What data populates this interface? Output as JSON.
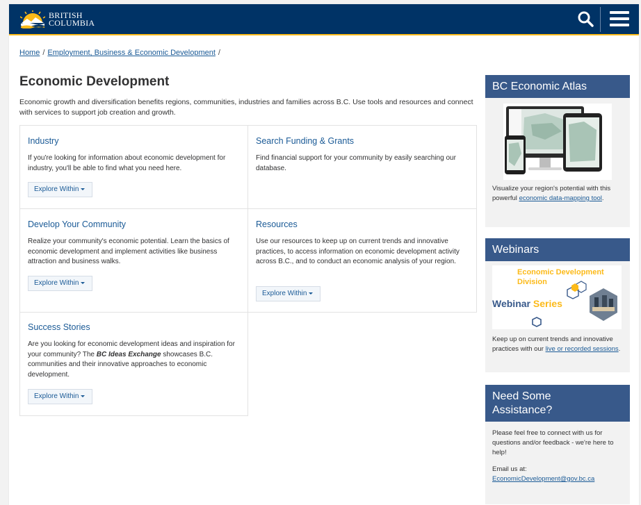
{
  "header": {
    "logo_line1": "BRITISH",
    "logo_line2": "COLUMBIA"
  },
  "breadcrumb": {
    "home": "Home",
    "sep1": "/",
    "section": "Employment, Business & Economic Development",
    "sep2": "/"
  },
  "page": {
    "title": "Economic Development",
    "intro": "Economic growth and diversification benefits regions, communities, industries and families across B.C. Use tools and resources and connect with services to support job creation and growth."
  },
  "cards": [
    {
      "title": "Industry",
      "text": "If you're looking for information about economic development for industry, you'll be able to find what you need here.",
      "button": "Explore Within"
    },
    {
      "title": "Search Funding & Grants",
      "text": "Find financial support for your community by easily searching our database."
    },
    {
      "title": "Develop Your Community",
      "text": "Realize your community's economic potential. Learn the basics of economic development and implement activities like business attraction and business walks.",
      "button": "Explore Within"
    },
    {
      "title": "Resources",
      "text": "Use our resources to keep up on current trends and innovative practices, to access information on economic development activity across B.C., and to conduct an economic analysis of your region.",
      "button": "Explore Within"
    },
    {
      "title": "Success Stories",
      "text_before": "Are you looking for economic development ideas and inspiration for your community? The ",
      "text_emphasis": "BC Ideas Exchange",
      "text_after": " showcases B.C. communities and their innovative approaches to economic development.",
      "button": "Explore Within"
    }
  ],
  "sidebar": {
    "atlas": {
      "heading": "BC Economic Atlas",
      "text_before": "Visualize your region's potential with this powerful ",
      "link": "economic data-mapping tool",
      "text_after": "."
    },
    "webinars": {
      "heading": "Webinars",
      "banner_line1": "Economic Development",
      "banner_line2": "Division",
      "banner_word1": "Webinar",
      "banner_word2": "Series",
      "text_before": "Keep up on current trends and innovative practices with our ",
      "link": "live or recorded sessions",
      "text_after": "."
    },
    "assist": {
      "heading_line1": "Need Some",
      "heading_line2": "Assistance?",
      "text": "Please feel free to connect with us for questions and/or feedback - we're here to help!",
      "email_label": "Email us at:",
      "email": "EconomicDevelopment@gov.bc.ca"
    }
  },
  "colors": {
    "header_bg": "#003366",
    "accent_gold": "#fcba19",
    "link": "#1a5a96",
    "sidebar_heading_bg": "#38598a"
  },
  "icons": {
    "search": "search-icon",
    "menu": "hamburger-menu-icon",
    "caret": "caret-down-icon"
  }
}
